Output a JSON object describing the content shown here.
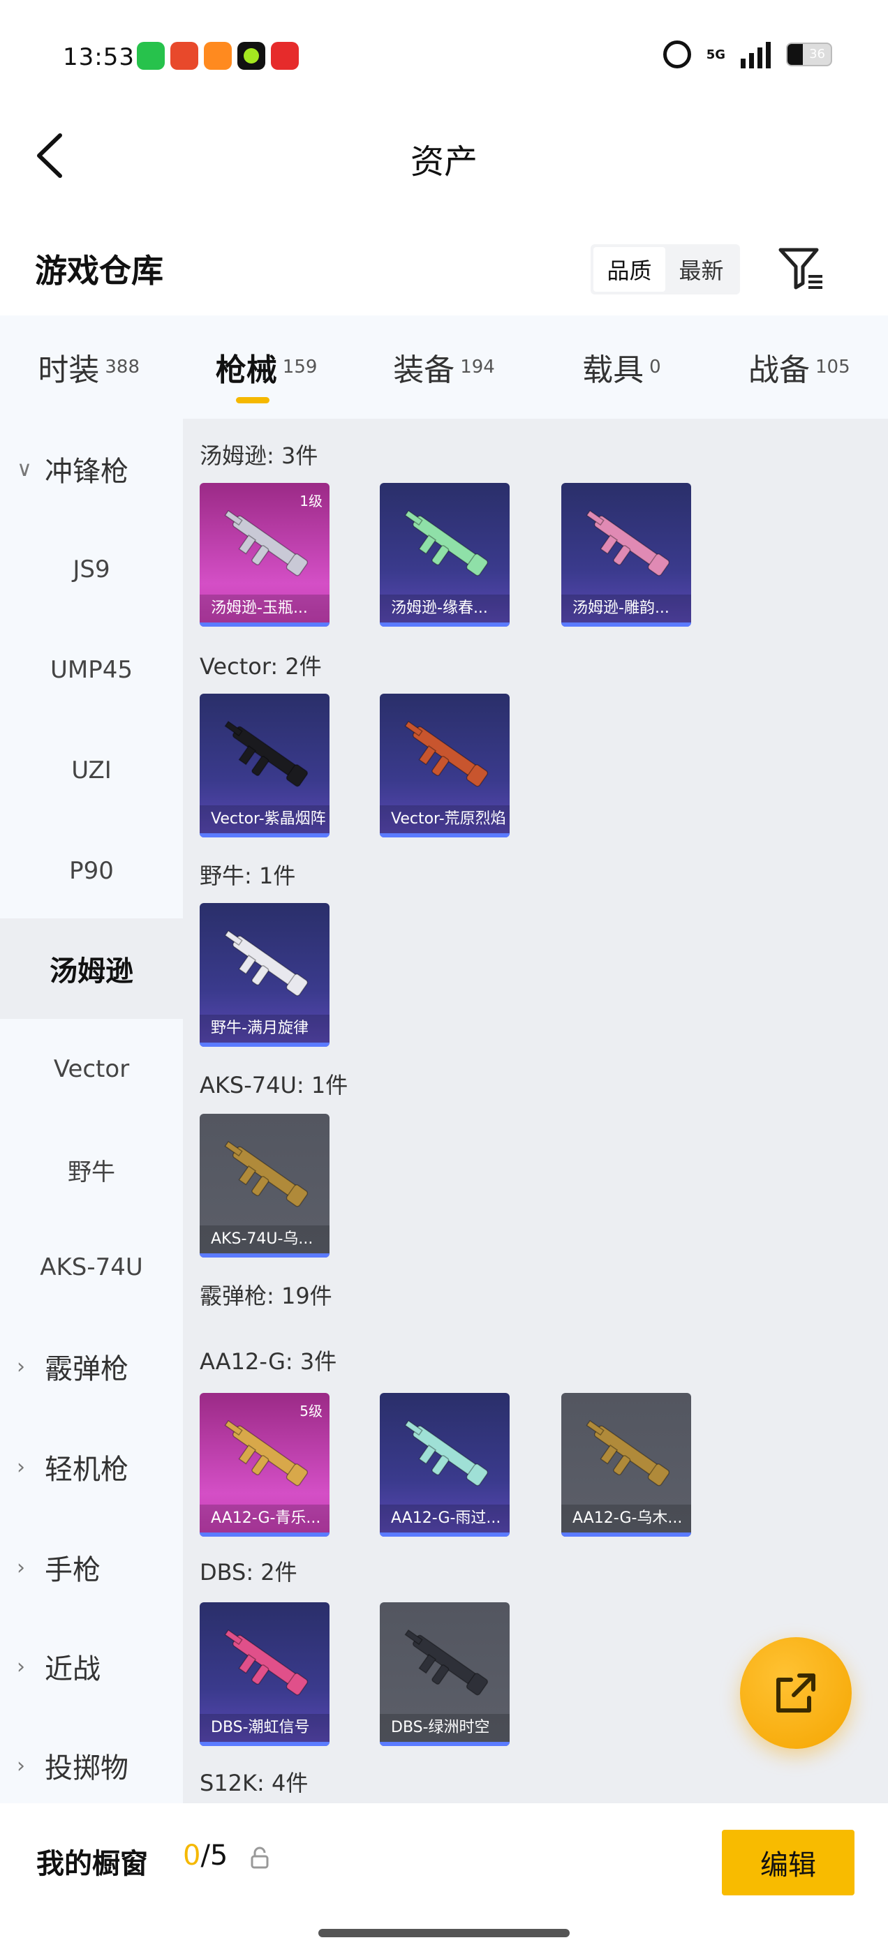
{
  "status_bar": {
    "time": "13:53",
    "network": "5G",
    "battery": "36"
  },
  "header": {
    "back_icon": "chevron-left-icon",
    "title": "资产"
  },
  "section": {
    "title": "游戏仓库",
    "sort_options": [
      "品质",
      "最新"
    ],
    "filter_icon": "filter-icon"
  },
  "tabs": [
    {
      "label": "时装",
      "count": "388"
    },
    {
      "label": "枪械",
      "count": "159",
      "active": true
    },
    {
      "label": "装备",
      "count": "194"
    },
    {
      "label": "载具",
      "count": "0"
    },
    {
      "label": "战备",
      "count": "105"
    }
  ],
  "sidebar": {
    "items": [
      {
        "label": "冲锋枪",
        "type": "category",
        "expanded": true
      },
      {
        "label": "JS9",
        "type": "sub"
      },
      {
        "label": "UMP45",
        "type": "sub"
      },
      {
        "label": "UZI",
        "type": "sub"
      },
      {
        "label": "P90",
        "type": "sub"
      },
      {
        "label": "汤姆逊",
        "type": "sub",
        "selected": true
      },
      {
        "label": "Vector",
        "type": "sub"
      },
      {
        "label": "野牛",
        "type": "sub"
      },
      {
        "label": "AKS-74U",
        "type": "sub"
      },
      {
        "label": "霰弹枪",
        "type": "category"
      },
      {
        "label": "轻机枪",
        "type": "category"
      },
      {
        "label": "手枪",
        "type": "category"
      },
      {
        "label": "近战",
        "type": "category"
      },
      {
        "label": "投掷物",
        "type": "category"
      }
    ]
  },
  "content": {
    "labels": {
      "thompson": "汤姆逊: 3件",
      "vector": "Vector: 2件",
      "bison": "野牛: 1件",
      "aks": "AKS-74U: 1件",
      "shotgun": "霰弹枪: 19件",
      "aa12": "AA12-G: 3件",
      "dbs": "DBS: 2件",
      "s12k": "S12K: 4件"
    },
    "cards": {
      "thompson": [
        {
          "name": "汤姆逊-玉瓶...",
          "level": "1级",
          "bg": "pink",
          "color": "#c9c9d6"
        },
        {
          "name": "汤姆逊-缘春...",
          "bg": "purple",
          "color": "#8fe0a8"
        },
        {
          "name": "汤姆逊-雕韵...",
          "bg": "purple",
          "color": "#e08ab4"
        }
      ],
      "vector": [
        {
          "name": "Vector-紫晶烟阵",
          "bg": "purple",
          "color": "#1a1a1e"
        },
        {
          "name": "Vector-荒原烈焰",
          "bg": "purple",
          "color": "#c8552e"
        }
      ],
      "bison": [
        {
          "name": "野牛-满月旋律",
          "bg": "purple",
          "color": "#e8e8ee"
        }
      ],
      "aks": [
        {
          "name": "AKS-74U-乌...",
          "bg": "gray",
          "color": "#b08a3a"
        }
      ],
      "aa12": [
        {
          "name": "AA12-G-青乐...",
          "level": "5级",
          "bg": "pink",
          "color": "#d8a84a"
        },
        {
          "name": "AA12-G-雨过...",
          "bg": "purple",
          "color": "#9fe0d6"
        },
        {
          "name": "AA12-G-乌木...",
          "bg": "gray",
          "color": "#b08a3a"
        }
      ],
      "dbs": [
        {
          "name": "DBS-潮虹信号",
          "bg": "purple",
          "color": "#e0508a"
        },
        {
          "name": "DBS-绿洲时空",
          "bg": "gray",
          "color": "#2e3038"
        }
      ]
    }
  },
  "fab": {
    "icon": "share-icon"
  },
  "bottom": {
    "showcase_label": "我的橱窗",
    "current": "0",
    "total": "/5",
    "lock_icon": "lock-icon",
    "edit_label": "编辑"
  },
  "colors": {
    "accent": "#f5b800",
    "sidebar_bg": "#f6f9fd",
    "content_bg": "#eceef2"
  }
}
